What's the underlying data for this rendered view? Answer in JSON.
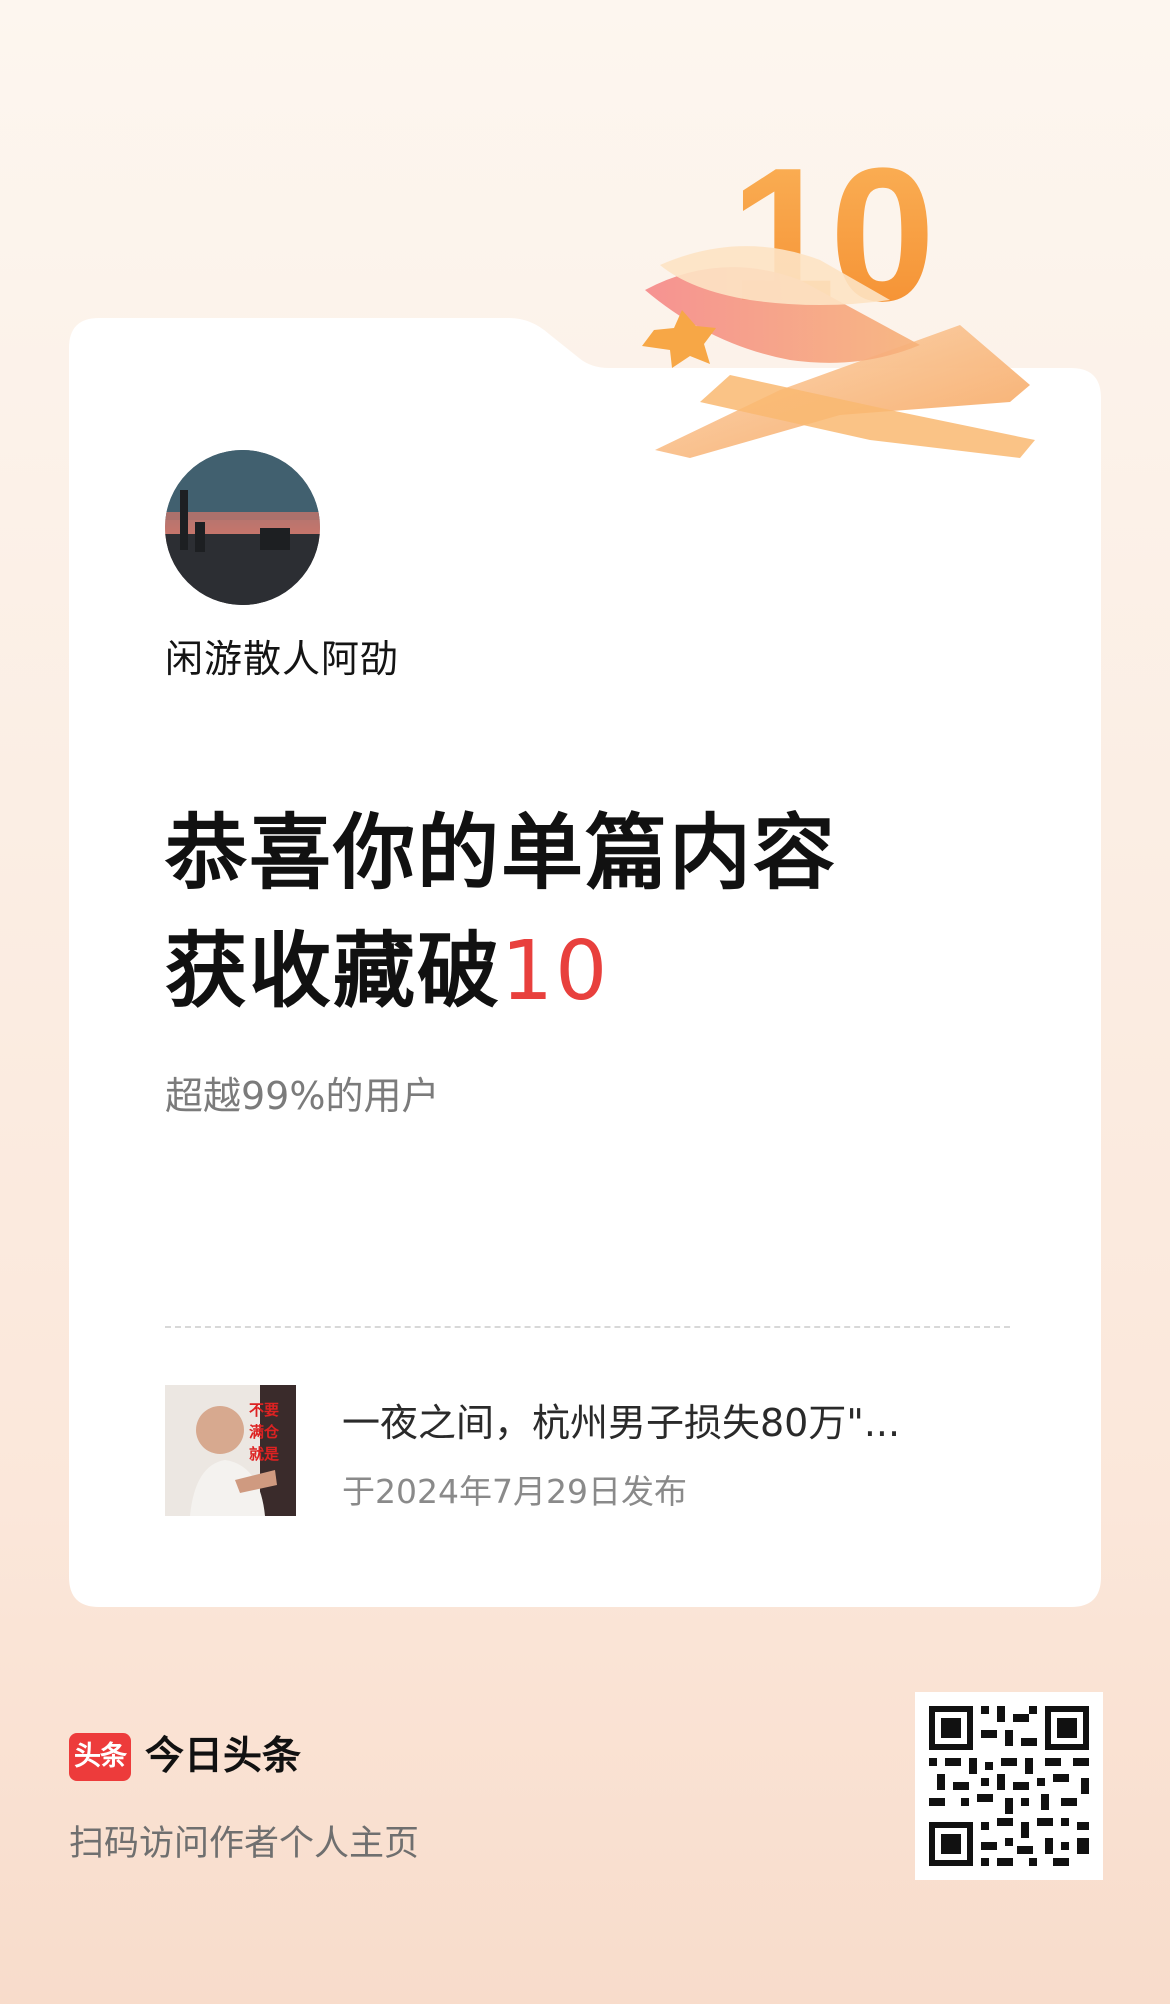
{
  "badge": {
    "number": "10"
  },
  "author": {
    "name": "闲游散人阿劭"
  },
  "headline": {
    "line1": "恭喜你的单篇内容",
    "line2_prefix": "获收藏破",
    "line2_number": "10"
  },
  "subline": "超越99%的用户",
  "article": {
    "title": "一夜之间，杭州男子损失80万\"...",
    "published": "于2024年7月29日发布",
    "thumb_text": [
      "不要",
      "满仓",
      "就是"
    ]
  },
  "footer": {
    "logo_text": "头条",
    "app_name": "今日头条",
    "scan_hint": "扫码访问作者个人主页"
  },
  "colors": {
    "accent_red": "#e8403d",
    "logo_red": "#ed3b3b",
    "badge_orange": "#f59a3b"
  }
}
